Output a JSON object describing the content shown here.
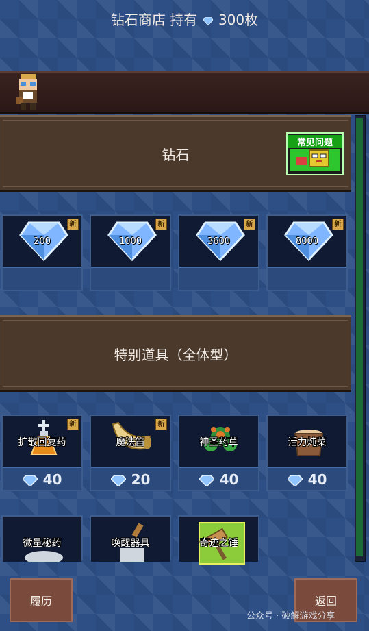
{
  "header": {
    "title_prefix": "钻石商店 持有",
    "title_suffix": "300枚"
  },
  "faq": {
    "label": "常见问题"
  },
  "sections": [
    {
      "title": "钻石"
    },
    {
      "title": "特别道具（全体型）"
    }
  ],
  "diamonds": [
    {
      "amount": "200",
      "new": "新"
    },
    {
      "amount": "1000",
      "new": "新"
    },
    {
      "amount": "3600",
      "new": "新"
    },
    {
      "amount": "8000",
      "new": "新"
    }
  ],
  "items_row1": [
    {
      "name": "扩散回复药",
      "price": "40",
      "new": "新"
    },
    {
      "name": "魔法笛",
      "price": "20",
      "new": "新"
    },
    {
      "name": "神圣药草",
      "price": "40"
    },
    {
      "name": "活力炖菜",
      "price": "40"
    }
  ],
  "items_row2": [
    {
      "name": "微量秘药"
    },
    {
      "name": "唤醒器具"
    },
    {
      "name": "奇迹之锤"
    }
  ],
  "buttons": {
    "history": "履历",
    "back": "返回"
  },
  "watermark": "公众号 · 破解游戏分享",
  "colors": {
    "accent_gem": "#8fc4ff",
    "scroll": "#1c6a36"
  }
}
